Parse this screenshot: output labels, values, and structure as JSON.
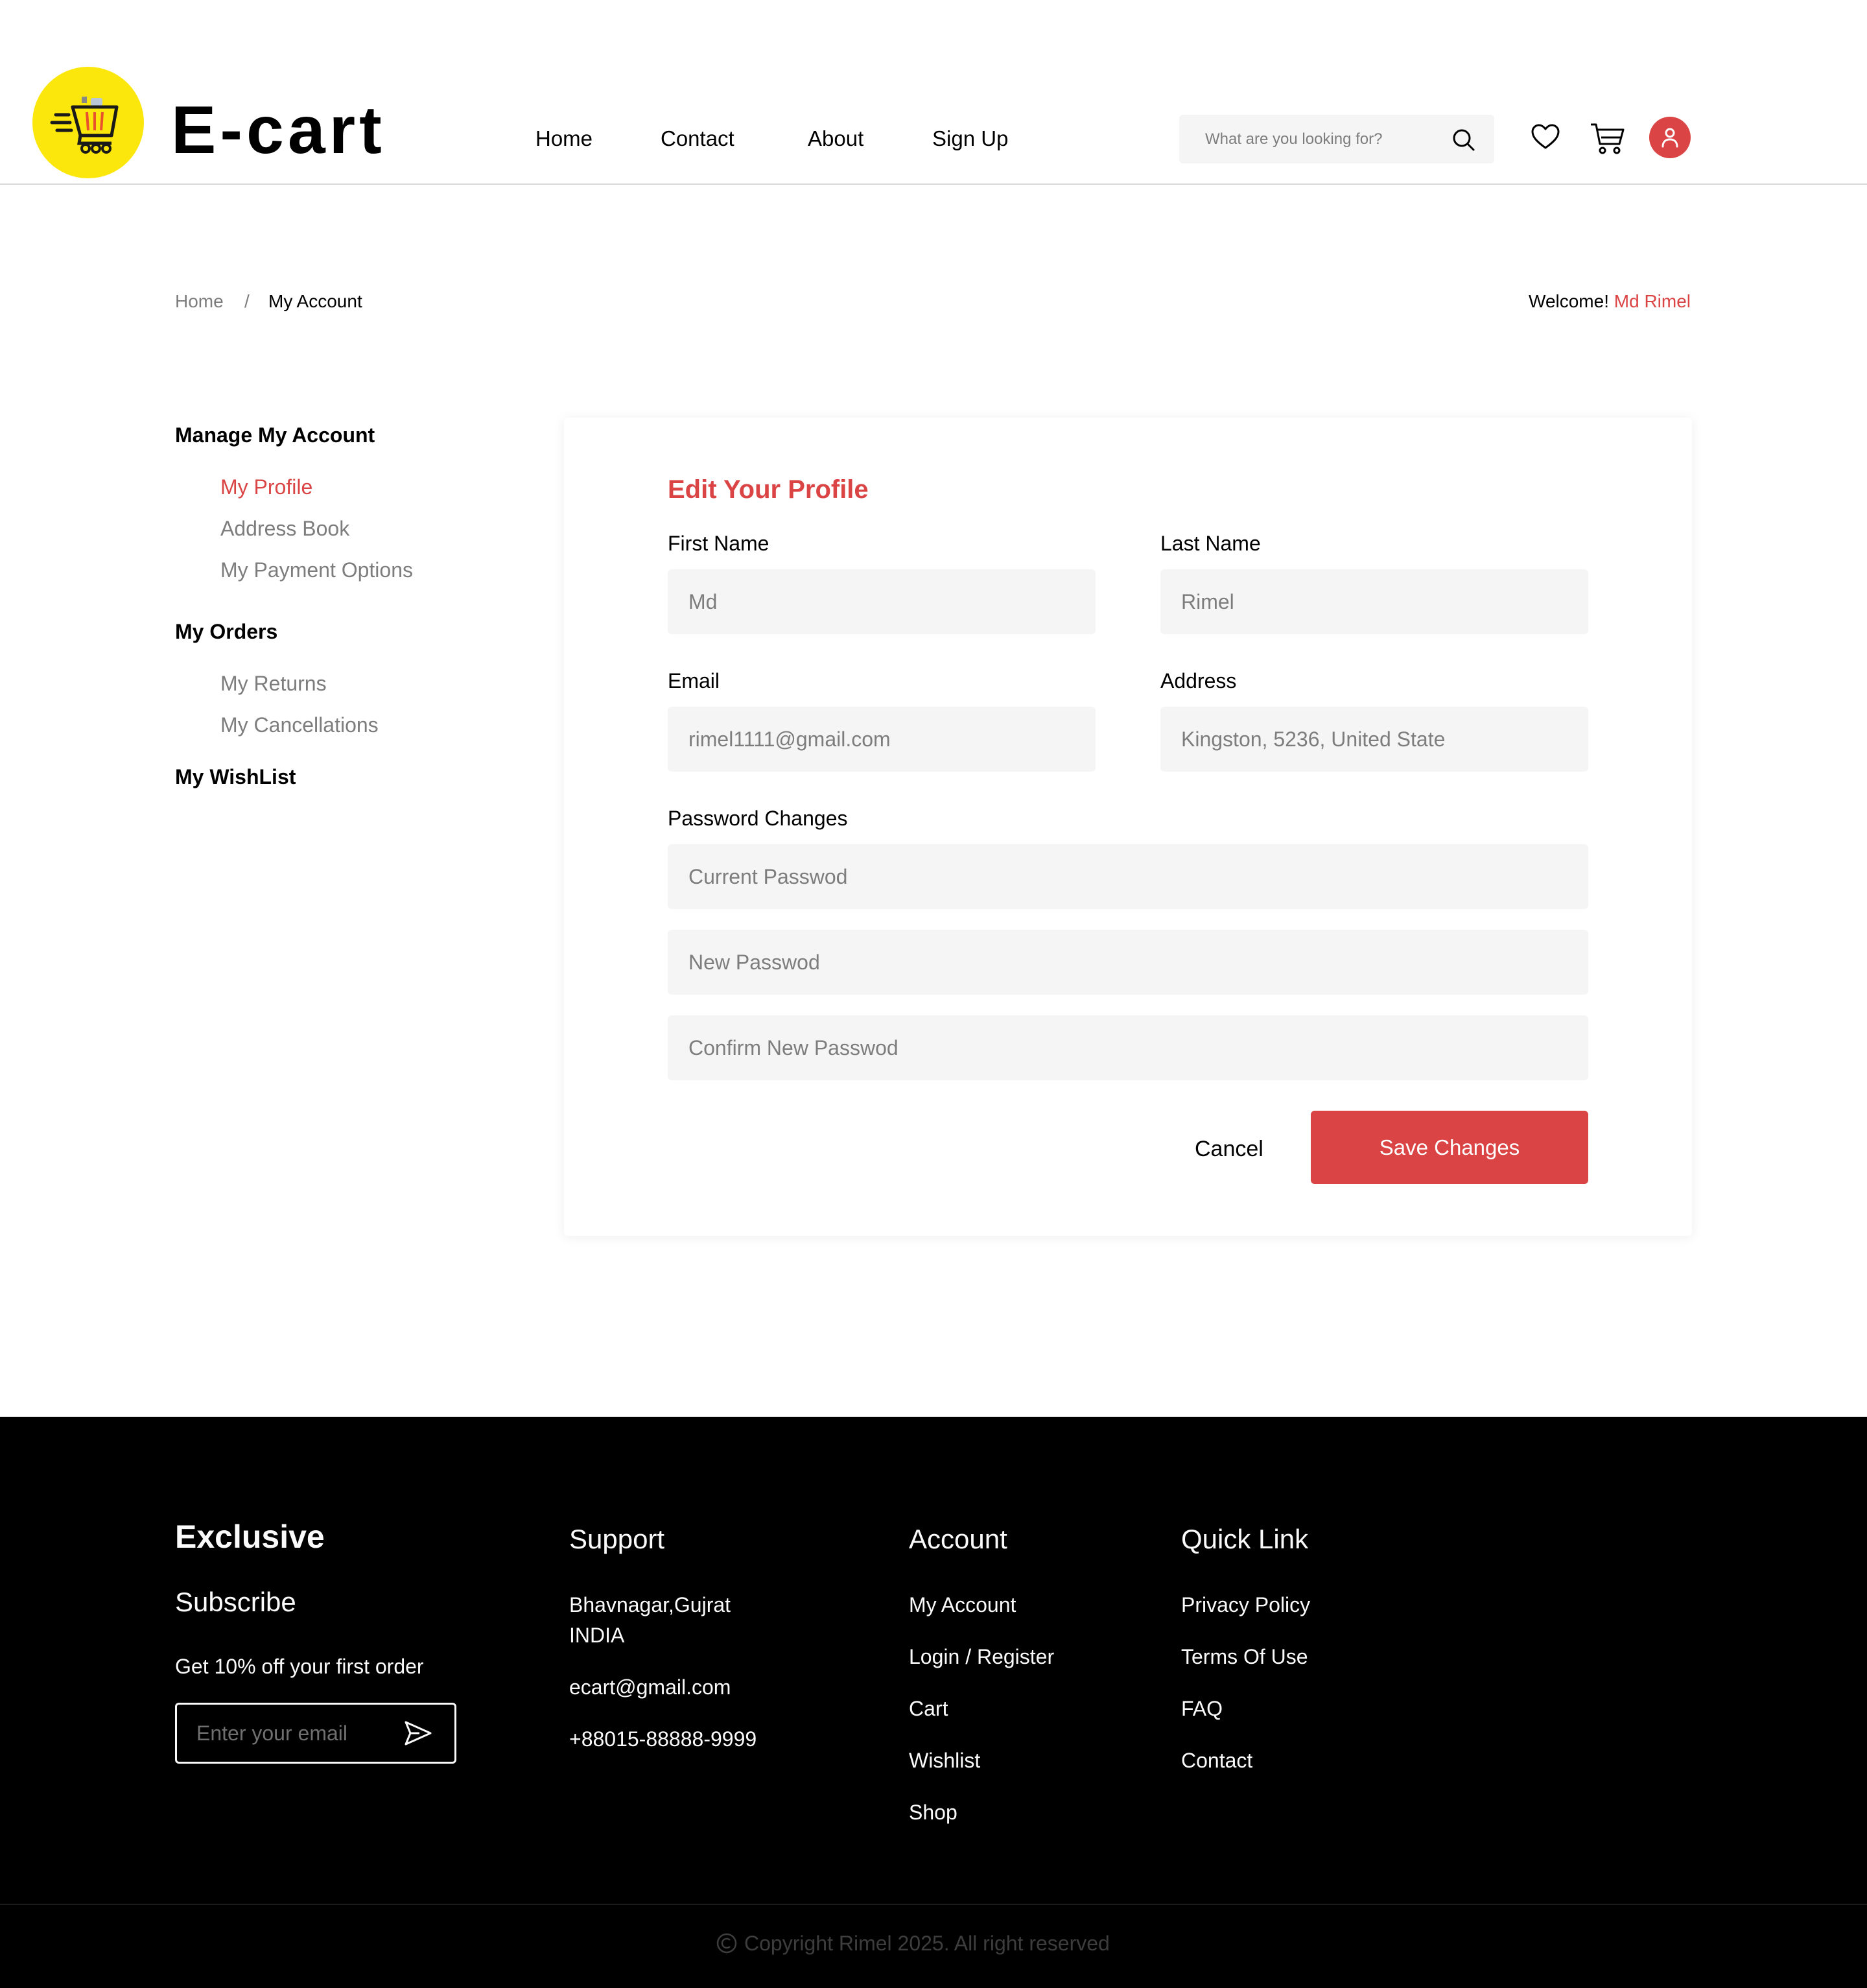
{
  "header": {
    "brand": "E-cart",
    "nav": [
      "Home",
      "Contact",
      "About",
      "Sign Up"
    ],
    "search_placeholder": "What are you looking for?",
    "icons": [
      "search-icon",
      "heart-icon",
      "cart-icon",
      "user-icon"
    ]
  },
  "breadcrumb": {
    "home": "Home",
    "separator": "/",
    "current": "My Account"
  },
  "welcome": {
    "label": "Welcome!",
    "name": "Md Rimel"
  },
  "sidebar": {
    "manage": "Manage My Account",
    "manage_items": [
      "My Profile",
      "Address Book",
      "My Payment Options"
    ],
    "orders": "My Orders",
    "order_items": [
      "My Returns",
      "My Cancellations"
    ],
    "wishlist": "My WishList"
  },
  "profile": {
    "title": "Edit Your Profile",
    "first_name_label": "First Name",
    "first_name_value": "Md",
    "last_name_label": "Last Name",
    "last_name_value": "Rimel",
    "email_label": "Email",
    "email_value": "rimel1111@gmail.com",
    "address_label": "Address",
    "address_value": "Kingston, 5236, United State",
    "password_label": "Password Changes",
    "current_password_placeholder": "Current Passwod",
    "new_password_placeholder": "New Passwod",
    "confirm_password_placeholder": "Confirm New Passwod",
    "cancel": "Cancel",
    "save": "Save Changes"
  },
  "footer": {
    "brand": "Exclusive",
    "subscribe_heading": "Subscribe",
    "subscribe_text": "Get 10% off your first order",
    "email_placeholder": "Enter your email",
    "support_heading": "Support",
    "support_address_1": "Bhavnagar,Gujrat",
    "support_address_2": "INDIA",
    "support_email": "ecart@gmail.com",
    "support_phone": "+88015-88888-9999",
    "account_heading": "Account",
    "account_links": [
      "My Account",
      "Login / Register",
      "Cart",
      "Wishlist",
      "Shop"
    ],
    "quick_heading": "Quick Link",
    "quick_links": [
      "Privacy Policy",
      "Terms Of Use",
      "FAQ",
      "Contact"
    ],
    "copyright": "Copyright Rimel 2025. All right reserved"
  },
  "colors": {
    "accent": "#db4444",
    "logo_yellow": "#fbe70b",
    "field_bg": "#f5f5f5",
    "muted_text": "#7d7d7d"
  }
}
